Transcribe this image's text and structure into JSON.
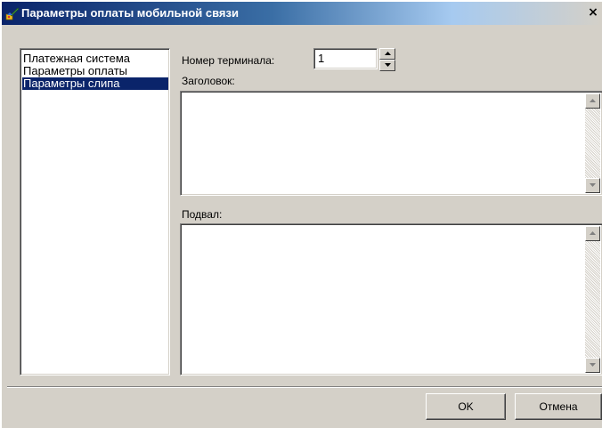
{
  "window": {
    "title": "Параметры оплаты мобильной связи",
    "close_glyph": "×",
    "icon": "app-brush-icon"
  },
  "nav": {
    "items": [
      {
        "label": "Платежная система",
        "selected": false
      },
      {
        "label": "Параметры оплаты",
        "selected": false
      },
      {
        "label": "Параметры слипа",
        "selected": true
      }
    ]
  },
  "form": {
    "terminal_label": "Номер терминала:",
    "terminal_value": "1",
    "header_label": "Заголовок:",
    "header_value": "",
    "footer_label": "Подвал:",
    "footer_value": ""
  },
  "buttons": {
    "ok": "OK",
    "cancel": "Отмена"
  },
  "colors": {
    "title_start": "#0a246a",
    "selection": "#0a246a",
    "face": "#d4d0c8"
  }
}
